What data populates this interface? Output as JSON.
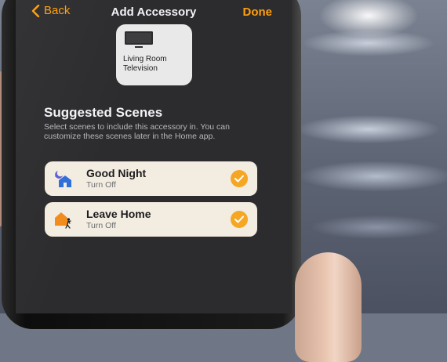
{
  "nav": {
    "back_label": "Back",
    "title": "Add Accessory",
    "done_label": "Done"
  },
  "accessory": {
    "name": "Living Room\nTelevision",
    "icon": "tv-icon"
  },
  "suggested": {
    "heading": "Suggested Scenes",
    "description": "Select scenes to include this accessory in. You can customize these scenes later in the Home app."
  },
  "scenes": [
    {
      "name": "Good Night",
      "status": "Turn Off",
      "icon": "good-night-icon",
      "selected": true
    },
    {
      "name": "Leave Home",
      "status": "Turn Off",
      "icon": "leave-home-icon",
      "selected": true
    }
  ],
  "colors": {
    "accent": "#ff9f0a",
    "check": "#f5a623",
    "sheet": "#2c2c2e",
    "card": "#f3ece1"
  }
}
